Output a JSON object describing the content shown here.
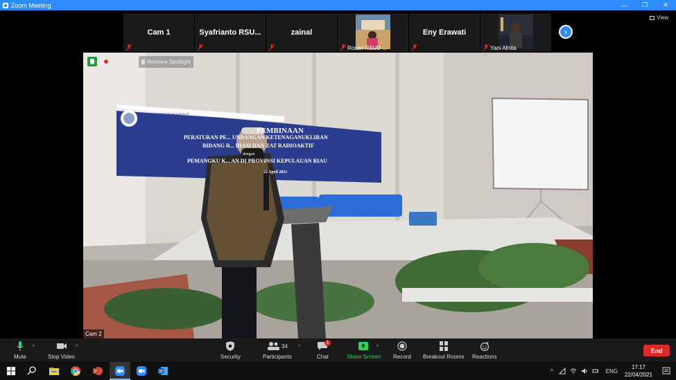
{
  "window": {
    "title": "Zoom Meeting"
  },
  "strip": {
    "tiles": [
      {
        "name": "Cam 1",
        "small": ""
      },
      {
        "name": "Syafrianto  RSU...",
        "small": ""
      },
      {
        "name": "zainal",
        "small": ""
      },
      {
        "name": "",
        "small": "Rosari  RSUD ..."
      },
      {
        "name": "Eny Erawati",
        "small": ""
      },
      {
        "name": "",
        "small": "Yani Afnita"
      }
    ],
    "view_label": "View"
  },
  "video": {
    "spotlight_label": "Remove Spotlight",
    "cam_label": "Cam 2",
    "banner_line1": "PEMBINAAN",
    "banner_line2": "PERATURAN PE... UNDANGAN KETENAGANUKLIRAN",
    "banner_line3": "BIDANG R... DIASI DAN ZAT RADIOAKTIF",
    "banner_line4": "dengan",
    "banner_line5": "PEMANGKU K... AN DI PROVINSI KEPULAUAN RIAU",
    "banner_line6": "22 April 2021",
    "banner_org": "BADAN PENGAWAS TENAGA NUKLIR"
  },
  "toolbar": {
    "mute": "Mute",
    "stop_video": "Stop Video",
    "security": "Security",
    "participants": "Participants",
    "participants_count": "34",
    "chat": "Chat",
    "chat_badge": "1",
    "share_screen": "Share Screen",
    "record": "Record",
    "breakout_rooms": "Breakout Rooms",
    "reactions": "Reactions",
    "end": "End"
  },
  "taskbar": {
    "lang": "ENG",
    "time": "17:17",
    "date": "22/04/2021"
  },
  "colors": {
    "zoom_blue": "#2d8cff",
    "end_red": "#e02828",
    "share_green": "#23d959"
  }
}
